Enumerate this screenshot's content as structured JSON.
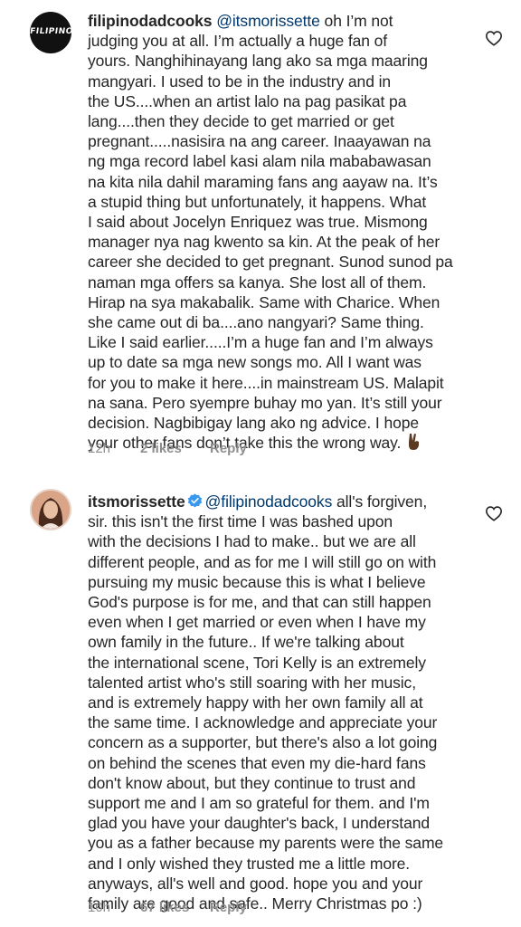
{
  "comments": [
    {
      "username": "filipinodadcooks",
      "avatar_text": "FILIPINO",
      "mention": "@itsmorissette",
      "lines": [
        " oh I’m not",
        "judging you at all.  I’m actually a huge fan of",
        "yours.  Nanghihinayang lang ako sa mga maaring",
        "mangyari.  I used to be in the industry and in",
        "the US....when an artist lalo na pag pasikat pa",
        "lang....then they decide to get married or get",
        "pregnant.....nasisira na ang career.  Inaayawan na",
        "ng mga record label kasi alam nila mababawasan",
        "na kita nila dahil maraming fans ang aayaw na.  It’s",
        "a stupid thing but unfortunately, it happens.  What",
        "I said about Jocelyn Enriquez was true.  Mismong",
        "manager nya nag kwento sa kin.  At the peak of her",
        "career she decided to get pregnant. Sunod sunod pa",
        "naman mga offers sa kanya.  She lost all of them.",
        "Hirap na sya makabalik.  Same with Charice.  When",
        "she came out di ba....ano nangyari?  Same thing.",
        "Like I said earlier.....I’m a huge fan and I’m always",
        "up to date sa mga new songs mo.  All I want was",
        "for you to make it here....in mainstream US.  Malapit",
        "na sana.  Pero syempre buhay mo yan.  It’s still your",
        "decision.  Nagbibigay lang ako ng advice.  I hope",
        "your other fans don’t take this the wrong way. "
      ],
      "time": "12h",
      "likes": "2 likes",
      "reply": "Reply"
    },
    {
      "username": "itsmorissette",
      "mention": "@filipinodadcooks",
      "lines": [
        " all's forgiven,",
        "sir. this isn't the first time I was bashed upon",
        "with the decisions I had to make.. but we are all",
        "different people, and as for me I will still go on with",
        "pursuing my music because this is what I believe",
        "God's purpose is for me, and that can still happen",
        "even when I get married or even when I have my",
        "own family in the future.. If we're talking about",
        "the international scene, Tori Kelly is an extremely",
        "talented artist who's still soaring with her music,",
        "and is extremely happy with her own family all at",
        "the same time. I acknowledge and appreciate your",
        "concern as a supporter, but there's also a lot going",
        "on behind the scenes that even my die-hard fans",
        "don't know about, but they continue to trust and",
        "support me and I am so grateful for them. and I'm",
        "glad you have your daughter's back, I understand",
        "you as a father because my parents were the same",
        "and I only wished they trusted me a little more.",
        "anyways, all's well and good. hope you and your",
        "family are good and safe.. Merry Christmas po :)"
      ],
      "time": "10h",
      "likes": "67 likes",
      "reply": "Reply"
    }
  ],
  "colors": {
    "text": "#262626",
    "mention": "#00376b",
    "meta": "#8e8e8e",
    "verified": "#3897f0"
  },
  "icons": {
    "like": "heart-outline-icon",
    "verified": "verified-badge-icon",
    "emoji": "victory-hand-emoji"
  }
}
